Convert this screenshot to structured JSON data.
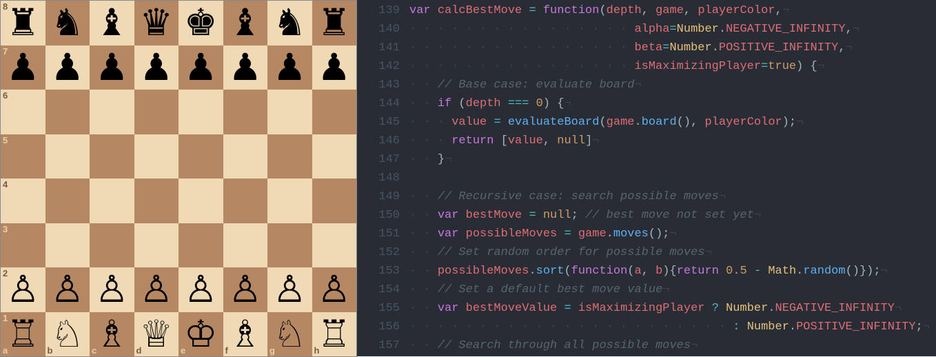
{
  "chess": {
    "rank_labels": [
      "8",
      "7",
      "6",
      "5",
      "4",
      "3",
      "2",
      "1"
    ],
    "file_labels": [
      "a",
      "b",
      "c",
      "d",
      "e",
      "f",
      "g",
      "h"
    ],
    "rows": [
      [
        "♜",
        "♞",
        "♝",
        "♛",
        "♚",
        "♝",
        "♞",
        "♜"
      ],
      [
        "♟",
        "♟",
        "♟",
        "♟",
        "♟",
        "♟",
        "♟",
        "♟"
      ],
      [
        "",
        "",
        "",
        "",
        "",
        "",
        "",
        ""
      ],
      [
        "",
        "",
        "",
        "",
        "",
        "",
        "",
        ""
      ],
      [
        "",
        "",
        "",
        "",
        "",
        "",
        "",
        ""
      ],
      [
        "",
        "",
        "",
        "",
        "",
        "",
        "",
        ""
      ],
      [
        "♙",
        "♙",
        "♙",
        "♙",
        "♙",
        "♙",
        "♙",
        "♙"
      ],
      [
        "♖",
        "♘",
        "♗",
        "♕",
        "♔",
        "♗",
        "♘",
        "♖"
      ]
    ]
  },
  "editor": {
    "first_line": 139,
    "lines": [
      [
        [
          "kw",
          "var"
        ],
        [
          "pun",
          " "
        ],
        [
          "name",
          "calcBestMove"
        ],
        [
          "pun",
          " "
        ],
        [
          "op",
          "="
        ],
        [
          "pun",
          " "
        ],
        [
          "fn",
          "function"
        ],
        [
          "pun",
          "("
        ],
        [
          "name",
          "depth"
        ],
        [
          "pun",
          ", "
        ],
        [
          "name",
          "game"
        ],
        [
          "pun",
          ", "
        ],
        [
          "name",
          "playerColor"
        ],
        [
          "pun",
          ","
        ],
        [
          "inv",
          "¬"
        ]
      ],
      [
        [
          "inv",
          "· · · · · · · · · · · · · · · · "
        ],
        [
          "name",
          "alpha"
        ],
        [
          "op",
          "="
        ],
        [
          "obj",
          "Number"
        ],
        [
          "pun",
          "."
        ],
        [
          "prop",
          "NEGATIVE_INFINITY"
        ],
        [
          "pun",
          ","
        ],
        [
          "inv",
          "¬"
        ]
      ],
      [
        [
          "inv",
          "· · · · · · · · · · · · · · · · "
        ],
        [
          "name",
          "beta"
        ],
        [
          "op",
          "="
        ],
        [
          "obj",
          "Number"
        ],
        [
          "pun",
          "."
        ],
        [
          "prop",
          "POSITIVE_INFINITY"
        ],
        [
          "pun",
          ","
        ],
        [
          "inv",
          "¬"
        ]
      ],
      [
        [
          "inv",
          "· · · · · · · · · · · · · · · · "
        ],
        [
          "name",
          "isMaximizingPlayer"
        ],
        [
          "op",
          "="
        ],
        [
          "bool",
          "true"
        ],
        [
          "pun",
          ") {"
        ],
        [
          "inv",
          "¬"
        ]
      ],
      [
        [
          "inv",
          "· · "
        ],
        [
          "cmt",
          "// Base case: evaluate board"
        ],
        [
          "inv",
          "¬"
        ]
      ],
      [
        [
          "inv",
          "· · "
        ],
        [
          "kw",
          "if"
        ],
        [
          "pun",
          " ("
        ],
        [
          "name",
          "depth"
        ],
        [
          "pun",
          " "
        ],
        [
          "op",
          "==="
        ],
        [
          "pun",
          " "
        ],
        [
          "num",
          "0"
        ],
        [
          "pun",
          ") {"
        ],
        [
          "inv",
          "¬"
        ]
      ],
      [
        [
          "inv",
          "· · · "
        ],
        [
          "name",
          "value"
        ],
        [
          "pun",
          " "
        ],
        [
          "op",
          "="
        ],
        [
          "pun",
          " "
        ],
        [
          "call",
          "evaluateBoard"
        ],
        [
          "pun",
          "("
        ],
        [
          "name",
          "game"
        ],
        [
          "pun",
          "."
        ],
        [
          "call",
          "board"
        ],
        [
          "pun",
          "(), "
        ],
        [
          "name",
          "playerColor"
        ],
        [
          "pun",
          ");"
        ],
        [
          "inv",
          "¬"
        ]
      ],
      [
        [
          "inv",
          "· · · "
        ],
        [
          "kw",
          "return"
        ],
        [
          "pun",
          " ["
        ],
        [
          "name",
          "value"
        ],
        [
          "pun",
          ", "
        ],
        [
          "null",
          "null"
        ],
        [
          "pun",
          "]"
        ],
        [
          "inv",
          "¬"
        ]
      ],
      [
        [
          "inv",
          "· · "
        ],
        [
          "pun",
          "}"
        ],
        [
          "inv",
          "¬"
        ]
      ],
      [
        [
          "inv",
          ""
        ]
      ],
      [
        [
          "inv",
          "· · "
        ],
        [
          "cmt",
          "// Recursive case: search possible moves"
        ],
        [
          "inv",
          "¬"
        ]
      ],
      [
        [
          "inv",
          "· · "
        ],
        [
          "kw",
          "var"
        ],
        [
          "pun",
          " "
        ],
        [
          "name",
          "bestMove"
        ],
        [
          "pun",
          " "
        ],
        [
          "op",
          "="
        ],
        [
          "pun",
          " "
        ],
        [
          "null",
          "null"
        ],
        [
          "pun",
          "; "
        ],
        [
          "cmt",
          "// best move not set yet"
        ],
        [
          "inv",
          "¬"
        ]
      ],
      [
        [
          "inv",
          "· · "
        ],
        [
          "kw",
          "var"
        ],
        [
          "pun",
          " "
        ],
        [
          "name",
          "possibleMoves"
        ],
        [
          "pun",
          " "
        ],
        [
          "op",
          "="
        ],
        [
          "pun",
          " "
        ],
        [
          "name",
          "game"
        ],
        [
          "pun",
          "."
        ],
        [
          "call",
          "moves"
        ],
        [
          "pun",
          "();"
        ],
        [
          "inv",
          "¬"
        ]
      ],
      [
        [
          "inv",
          "· · "
        ],
        [
          "cmt",
          "// Set random order for possible moves"
        ],
        [
          "inv",
          "¬"
        ]
      ],
      [
        [
          "inv",
          "· · "
        ],
        [
          "name",
          "possibleMoves"
        ],
        [
          "pun",
          "."
        ],
        [
          "call",
          "sort"
        ],
        [
          "pun",
          "("
        ],
        [
          "fn",
          "function"
        ],
        [
          "pun",
          "("
        ],
        [
          "name",
          "a"
        ],
        [
          "pun",
          ", "
        ],
        [
          "name",
          "b"
        ],
        [
          "pun",
          "){"
        ],
        [
          "kw",
          "return"
        ],
        [
          "pun",
          " "
        ],
        [
          "num",
          "0.5"
        ],
        [
          "pun",
          " "
        ],
        [
          "op",
          "-"
        ],
        [
          "pun",
          " "
        ],
        [
          "obj",
          "Math"
        ],
        [
          "pun",
          "."
        ],
        [
          "call",
          "random"
        ],
        [
          "pun",
          "()});"
        ],
        [
          "inv",
          "¬"
        ]
      ],
      [
        [
          "inv",
          "· · "
        ],
        [
          "cmt",
          "// Set a default best move value"
        ],
        [
          "inv",
          "¬"
        ]
      ],
      [
        [
          "inv",
          "· · "
        ],
        [
          "kw",
          "var"
        ],
        [
          "pun",
          " "
        ],
        [
          "name",
          "bestMoveValue"
        ],
        [
          "pun",
          " "
        ],
        [
          "op",
          "="
        ],
        [
          "pun",
          " "
        ],
        [
          "name",
          "isMaximizingPlayer"
        ],
        [
          "pun",
          " "
        ],
        [
          "op",
          "?"
        ],
        [
          "pun",
          " "
        ],
        [
          "obj",
          "Number"
        ],
        [
          "pun",
          "."
        ],
        [
          "prop",
          "NEGATIVE_INFINITY"
        ],
        [
          "inv",
          "¬"
        ]
      ],
      [
        [
          "inv",
          "· · · · · · · · · · · · · · · · · · · · · · · "
        ],
        [
          "op",
          ":"
        ],
        [
          "pun",
          " "
        ],
        [
          "obj",
          "Number"
        ],
        [
          "pun",
          "."
        ],
        [
          "prop",
          "POSITIVE_INFINITY"
        ],
        [
          "pun",
          ";"
        ],
        [
          "inv",
          "¬"
        ]
      ],
      [
        [
          "inv",
          "· · "
        ],
        [
          "cmt",
          "// Search through all possible moves"
        ],
        [
          "inv",
          "¬"
        ]
      ]
    ]
  }
}
